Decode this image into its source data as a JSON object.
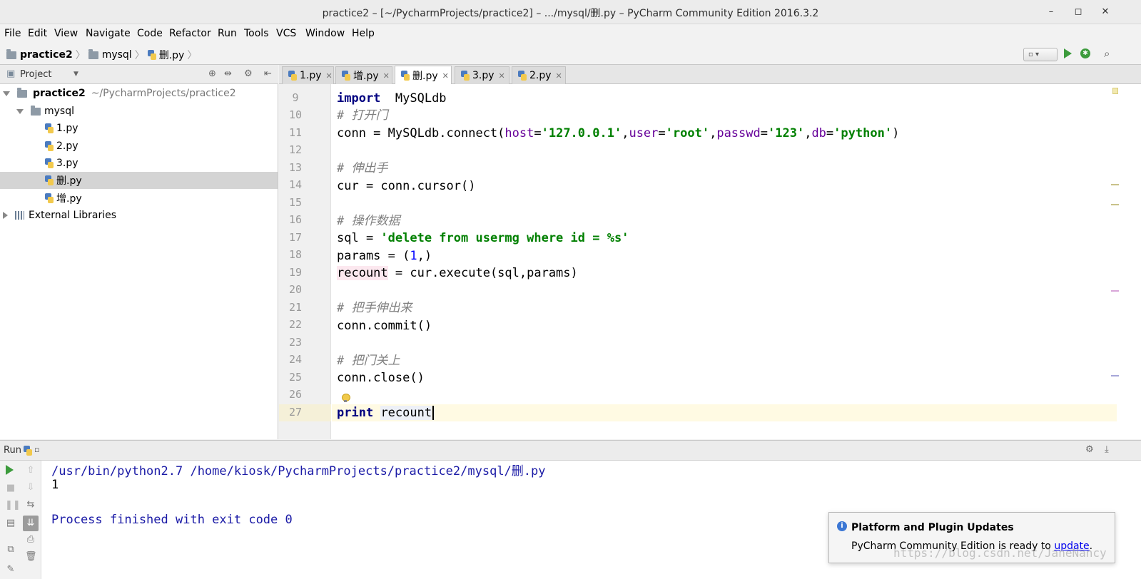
{
  "window": {
    "title": "practice2 – [~/PycharmProjects/practice2] – .../mysql/删.py – PyCharm Community Edition 2016.3.2",
    "minimize": "–",
    "maximize": "◻",
    "close": "✕"
  },
  "menu": [
    "File",
    "Edit",
    "View",
    "Navigate",
    "Code",
    "Refactor",
    "Run",
    "Tools",
    "VCS",
    "Window",
    "Help"
  ],
  "breadcrumb": [
    "practice2",
    "mysql",
    "删.py"
  ],
  "toolbar": {
    "run_config_label": "▫ ▾"
  },
  "project_panel": {
    "title": "Project",
    "root": {
      "name": "practice2",
      "path": "~/PycharmProjects/practice2"
    },
    "folder": "mysql",
    "files": [
      "1.py",
      "2.py",
      "3.py",
      "删.py",
      "增.py"
    ],
    "selected_file": "删.py",
    "libraries": "External Libraries"
  },
  "tabs": [
    {
      "label": "1.py",
      "active": false
    },
    {
      "label": "增.py",
      "active": false
    },
    {
      "label": "删.py",
      "active": true
    },
    {
      "label": "3.py",
      "active": false
    },
    {
      "label": "2.py",
      "active": false
    }
  ],
  "editor": {
    "line_numbers": [
      "9",
      "10",
      "11",
      "12",
      "13",
      "14",
      "15",
      "16",
      "17",
      "18",
      "19",
      "20",
      "21",
      "22",
      "23",
      "24",
      "25",
      "26",
      "27"
    ],
    "code": {
      "l9_kw": "import",
      "l9_rest": "  MySQLdb",
      "l10": "# 打开门",
      "l11_a": "conn = MySQLdb.connect(",
      "l11_host": "host",
      "l11_eq1": "=",
      "l11_host_val": "'127.0.0.1'",
      "l11_c1": ",",
      "l11_user": "user",
      "l11_eq2": "=",
      "l11_user_val": "'root'",
      "l11_c2": ",",
      "l11_passwd": "passwd",
      "l11_eq3": "=",
      "l11_passwd_val": "'123'",
      "l11_c3": ",",
      "l11_db": "db",
      "l11_eq4": "=",
      "l11_db_val": "'python'",
      "l11_end": ")",
      "l13": "# 伸出手",
      "l14": "cur = conn.cursor()",
      "l16": "# 操作数据",
      "l17_a": "sql = ",
      "l17_str": "'delete from usermg where id = %s'",
      "l18_a": "params = (",
      "l18_num": "1",
      "l18_b": ",)",
      "l19_var": "recount",
      "l19_rest": " = cur.execute(sql,params)",
      "l21": "# 把手伸出来",
      "l22": "conn.commit()",
      "l24": "# 把门关上",
      "l25": "conn.close()",
      "l27_kw": "print",
      "l27_var": "recount"
    }
  },
  "run_panel": {
    "label": "Run",
    "console": [
      "/usr/bin/python2.7 /home/kiosk/PycharmProjects/practice2/mysql/删.py",
      "1",
      "",
      "Process finished with exit code 0"
    ]
  },
  "notification": {
    "title": "Platform and Plugin Updates",
    "text": "PyCharm Community Edition is ready to ",
    "link": "update",
    "suffix": "."
  },
  "watermark": "https://blog.csdn.net/JaneNancy"
}
